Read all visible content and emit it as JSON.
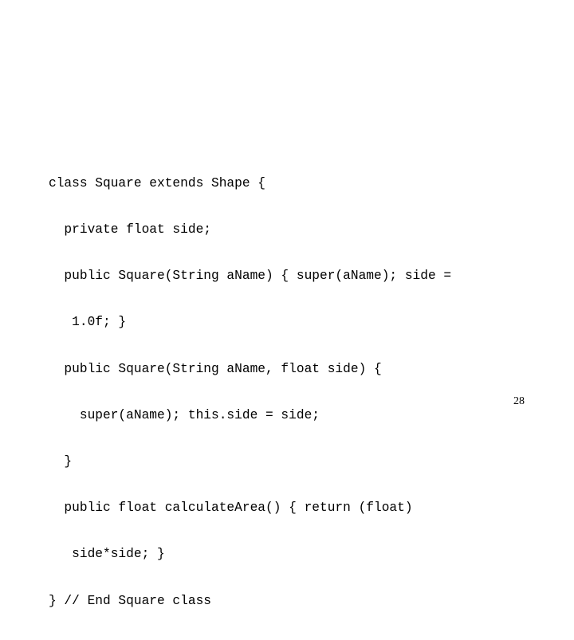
{
  "slide": {
    "code_lines": [
      "class Square extends Shape {",
      "  private float side;",
      "  public Square(String aName) { super(aName); side =",
      "   1.0f; }",
      "  public Square(String aName, float side) {",
      "    super(aName); this.side = side;",
      "  }",
      "  public float calculateArea() { return (float)",
      "   side*side; }",
      "} // End Square class"
    ],
    "page_number": "28"
  }
}
